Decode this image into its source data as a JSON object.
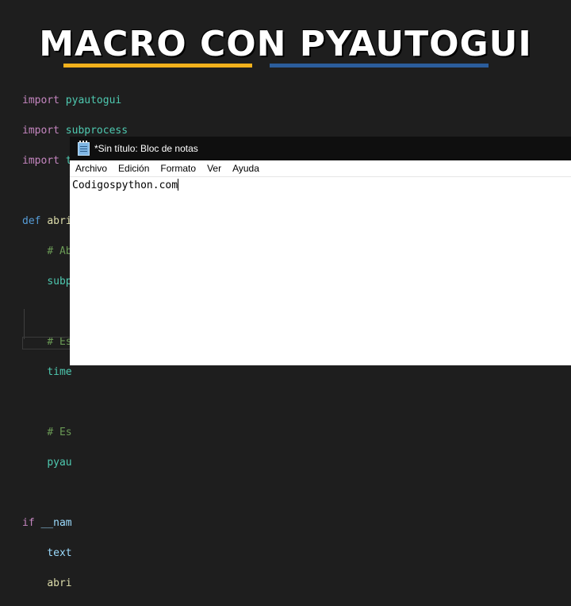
{
  "banner": {
    "title": "MACRO CON PYAUTOGUI"
  },
  "code": {
    "line1_kw": "import",
    "line1_mod": "pyautogui",
    "line2_kw": "import",
    "line2_mod": "subprocess",
    "line3_kw": "import",
    "line3_mod": "time",
    "line5_kw": "def",
    "line5_fn": "abri",
    "line6": "# Ab",
    "line7": "subp",
    "line9": "# Es",
    "line10": "time",
    "line12": "# Es",
    "line13": "pyau",
    "line15_kw": "if",
    "line15_rest": "__nam",
    "line16": "text",
    "line17": "abri"
  },
  "notepad": {
    "title": "*Sin título: Bloc de notas",
    "menu": [
      "Archivo",
      "Edición",
      "Formato",
      "Ver",
      "Ayuda"
    ],
    "content": "Codigospython.com"
  }
}
